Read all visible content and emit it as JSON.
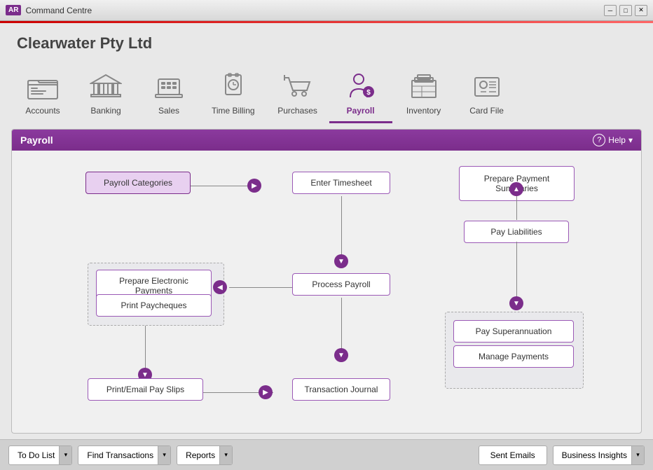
{
  "titleBar": {
    "logo": "AR",
    "title": "Command Centre",
    "controls": [
      "minimize",
      "maximize",
      "close"
    ]
  },
  "company": {
    "name": "Clearwater Pty Ltd"
  },
  "nav": {
    "items": [
      {
        "id": "accounts",
        "label": "Accounts",
        "icon": "folder-icon",
        "active": false
      },
      {
        "id": "banking",
        "label": "Banking",
        "icon": "bank-icon",
        "active": false
      },
      {
        "id": "sales",
        "label": "Sales",
        "icon": "register-icon",
        "active": false
      },
      {
        "id": "time-billing",
        "label": "Time Billing",
        "icon": "clock-icon",
        "active": false
      },
      {
        "id": "purchases",
        "label": "Purchases",
        "icon": "cart-icon",
        "active": false
      },
      {
        "id": "payroll",
        "label": "Payroll",
        "icon": "payroll-icon",
        "active": true
      },
      {
        "id": "inventory",
        "label": "Inventory",
        "icon": "inventory-icon",
        "active": false
      },
      {
        "id": "card-file",
        "label": "Card File",
        "icon": "cardfile-icon",
        "active": false
      }
    ]
  },
  "panel": {
    "title": "Payroll",
    "helpLabel": "Help"
  },
  "flowItems": {
    "payrollCategories": "Payroll Categories",
    "enterTimesheet": "Enter Timesheet",
    "preparePaymentSummaries": "Prepare Payment Summaries",
    "payLiabilities": "Pay Liabilities",
    "prepareElectronicPayments": "Prepare Electronic Payments",
    "printPaycheques": "Print Paycheques",
    "processPayroll": "Process Payroll",
    "printEmailPaySlips": "Print/Email Pay Slips",
    "transactionJournal": "Transaction Journal",
    "paySuperannuation": "Pay Superannuation",
    "managePayments": "Manage Payments"
  },
  "bottomBar": {
    "toDoList": "To Do List",
    "findTransactions": "Find Transactions",
    "reports": "Reports",
    "sentEmails": "Sent Emails",
    "businessInsights": "Business Insights"
  }
}
